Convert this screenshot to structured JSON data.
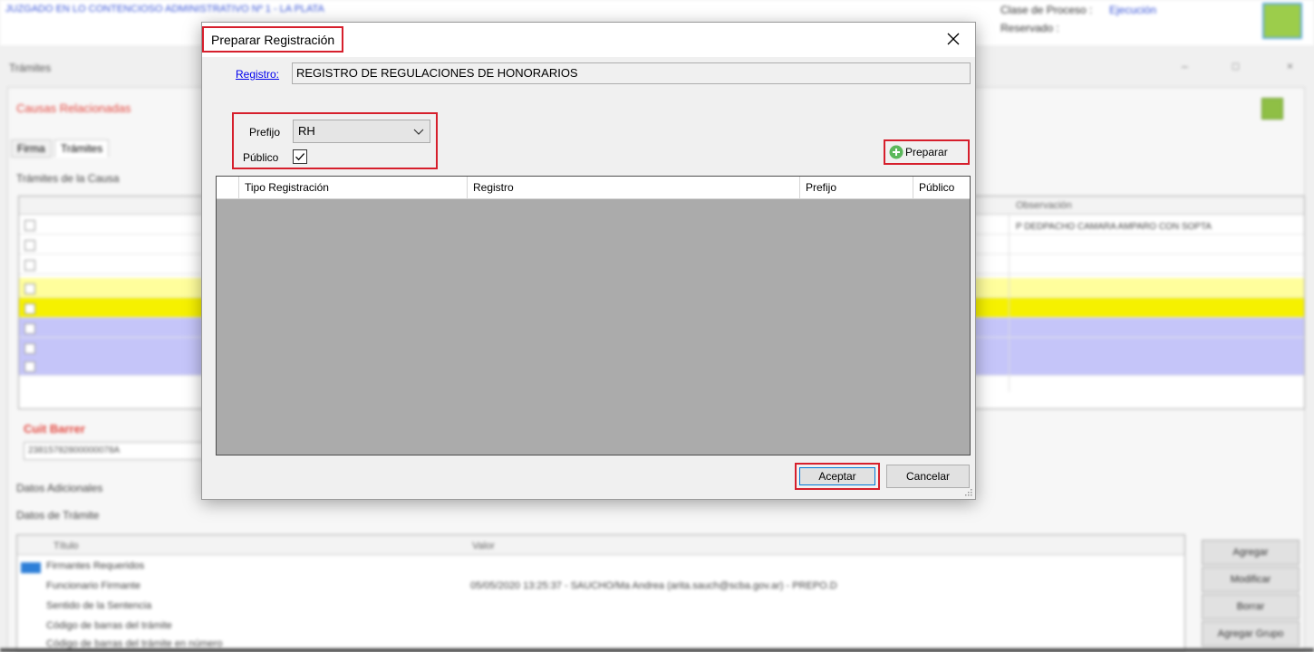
{
  "background": {
    "court_name": "JUZGADO EN LO CONTENCIOSO ADMINISTRATIVO Nº 1 - LA PLATA",
    "clase_proceso_label": "Clase de Proceso :",
    "clase_proceso_value": "Ejecución",
    "reservado_label": "Reservado :",
    "window_title": "Trámites",
    "causas_label": "Causas Relacionadas",
    "tabs": [
      "Firma",
      "Trámites"
    ],
    "tramites_section": "Trámites de la Causa",
    "observacion_header": "Observación",
    "observacion_text": "P DEDPACHO CAMARA AMPARO CON SOPTA",
    "cuit_label": "Cuit Barrer",
    "cuit_value": "23815782800000078A",
    "datos_adicionales": "Datos Adicionales",
    "datos_tramite": "Datos de Trámite",
    "t2_headers": [
      "Título",
      "Valor"
    ],
    "t2_rows": [
      "Firmantes Requeridos",
      "Funcionario Firmante",
      "Sentido de la Sentencia",
      "Código de barras del trámite",
      "Código de barras del trámite en número"
    ],
    "t2_value": "05/05/2020 13:25:37 - SAUCHO/Ma Andrea (arita.sauch@scba.gov.ar) - PREPO.D",
    "side_buttons": [
      "Agregar",
      "Modificar",
      "Borrar",
      "Agregar Grupo"
    ]
  },
  "dialog": {
    "title": "Preparar Registración",
    "registro_link": "Registro:",
    "registro_value": "REGISTRO DE REGULACIONES DE HONORARIOS",
    "prefijo_label": "Prefijo",
    "prefijo_value": "RH",
    "publico_label": "Público",
    "publico_checked": true,
    "preparar_label": "Preparar",
    "grid_headers": [
      "Tipo Registración",
      "Registro",
      "Prefijo",
      "Público"
    ],
    "aceptar_label": "Aceptar",
    "cancelar_label": "Cancelar"
  },
  "colors": {
    "highlight": "#d61f2c",
    "grid_empty": "#ababab",
    "link": "#0000ee",
    "preparar_icon": "#5cb85c"
  },
  "icons": [
    "close-icon",
    "chevron-down-icon",
    "checkmark-icon",
    "plus-circle-icon",
    "resize-grip-icon"
  ]
}
